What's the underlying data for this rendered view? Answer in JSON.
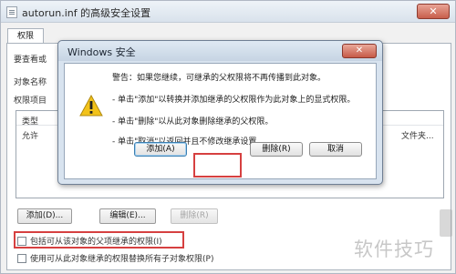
{
  "background_window": {
    "title": "autorun.inf 的高级安全设置",
    "tab": "权限",
    "text_line1": "要查看或",
    "text_line2": "对象名称",
    "text_line3": "权限项目",
    "list_header_type": "类型",
    "list_row_type": "允许",
    "list_row_right": "文件夹...",
    "buttons": {
      "add": "添加(D)...",
      "edit": "编辑(E)...",
      "delete": "删除(R)"
    },
    "checkbox_inherit": "包括可从该对象的父项继承的权限(I)",
    "checkbox_replace": "使用可从此对象继承的权限替换所有子对象权限(P)"
  },
  "dialog": {
    "title": "Windows 安全",
    "messages": [
      "警告：如果您继续，可继承的父权限将不再传播到此对象。",
      "- 单击\"添加\"以转换并添加继承的父权限作为此对象上的显式权限。",
      "- 单击\"删除\"以从此对象删除继承的父权限。",
      "- 单击\"取消\"以返回并且不修改继承设置。"
    ],
    "buttons": {
      "add": "添加(A)",
      "remove": "删除(R)",
      "cancel": "取消"
    }
  },
  "watermark": {
    "text": "软件技巧"
  },
  "colors": {
    "highlight_box": "#d64040",
    "dialog_frame": "#d8e3ef",
    "warning_yellow": "#f2c21a"
  }
}
